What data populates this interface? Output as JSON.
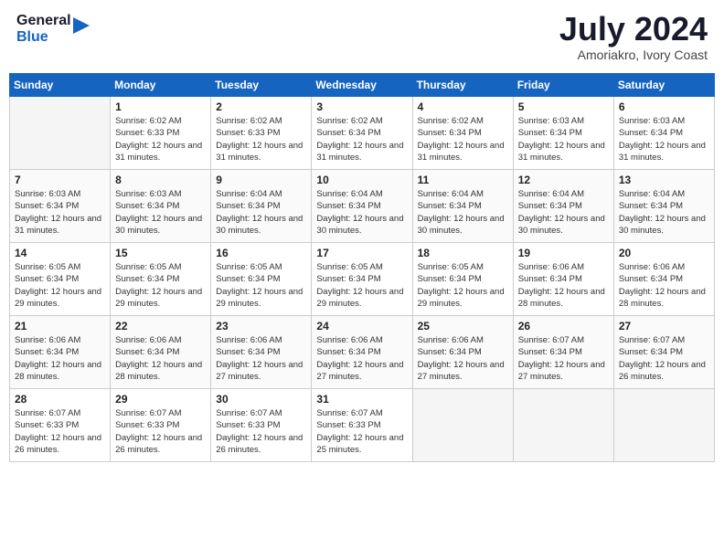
{
  "header": {
    "logo_line1": "General",
    "logo_line2": "Blue",
    "month": "July 2024",
    "location": "Amoriakro, Ivory Coast"
  },
  "days_of_week": [
    "Sunday",
    "Monday",
    "Tuesday",
    "Wednesday",
    "Thursday",
    "Friday",
    "Saturday"
  ],
  "weeks": [
    [
      {
        "day": "",
        "empty": true
      },
      {
        "day": "1",
        "sunrise": "6:02 AM",
        "sunset": "6:33 PM",
        "daylight": "12 hours and 31 minutes."
      },
      {
        "day": "2",
        "sunrise": "6:02 AM",
        "sunset": "6:33 PM",
        "daylight": "12 hours and 31 minutes."
      },
      {
        "day": "3",
        "sunrise": "6:02 AM",
        "sunset": "6:34 PM",
        "daylight": "12 hours and 31 minutes."
      },
      {
        "day": "4",
        "sunrise": "6:02 AM",
        "sunset": "6:34 PM",
        "daylight": "12 hours and 31 minutes."
      },
      {
        "day": "5",
        "sunrise": "6:03 AM",
        "sunset": "6:34 PM",
        "daylight": "12 hours and 31 minutes."
      },
      {
        "day": "6",
        "sunrise": "6:03 AM",
        "sunset": "6:34 PM",
        "daylight": "12 hours and 31 minutes."
      }
    ],
    [
      {
        "day": "7",
        "sunrise": "6:03 AM",
        "sunset": "6:34 PM",
        "daylight": "12 hours and 31 minutes."
      },
      {
        "day": "8",
        "sunrise": "6:03 AM",
        "sunset": "6:34 PM",
        "daylight": "12 hours and 30 minutes."
      },
      {
        "day": "9",
        "sunrise": "6:04 AM",
        "sunset": "6:34 PM",
        "daylight": "12 hours and 30 minutes."
      },
      {
        "day": "10",
        "sunrise": "6:04 AM",
        "sunset": "6:34 PM",
        "daylight": "12 hours and 30 minutes."
      },
      {
        "day": "11",
        "sunrise": "6:04 AM",
        "sunset": "6:34 PM",
        "daylight": "12 hours and 30 minutes."
      },
      {
        "day": "12",
        "sunrise": "6:04 AM",
        "sunset": "6:34 PM",
        "daylight": "12 hours and 30 minutes."
      },
      {
        "day": "13",
        "sunrise": "6:04 AM",
        "sunset": "6:34 PM",
        "daylight": "12 hours and 30 minutes."
      }
    ],
    [
      {
        "day": "14",
        "sunrise": "6:05 AM",
        "sunset": "6:34 PM",
        "daylight": "12 hours and 29 minutes."
      },
      {
        "day": "15",
        "sunrise": "6:05 AM",
        "sunset": "6:34 PM",
        "daylight": "12 hours and 29 minutes."
      },
      {
        "day": "16",
        "sunrise": "6:05 AM",
        "sunset": "6:34 PM",
        "daylight": "12 hours and 29 minutes."
      },
      {
        "day": "17",
        "sunrise": "6:05 AM",
        "sunset": "6:34 PM",
        "daylight": "12 hours and 29 minutes."
      },
      {
        "day": "18",
        "sunrise": "6:05 AM",
        "sunset": "6:34 PM",
        "daylight": "12 hours and 29 minutes."
      },
      {
        "day": "19",
        "sunrise": "6:06 AM",
        "sunset": "6:34 PM",
        "daylight": "12 hours and 28 minutes."
      },
      {
        "day": "20",
        "sunrise": "6:06 AM",
        "sunset": "6:34 PM",
        "daylight": "12 hours and 28 minutes."
      }
    ],
    [
      {
        "day": "21",
        "sunrise": "6:06 AM",
        "sunset": "6:34 PM",
        "daylight": "12 hours and 28 minutes."
      },
      {
        "day": "22",
        "sunrise": "6:06 AM",
        "sunset": "6:34 PM",
        "daylight": "12 hours and 28 minutes."
      },
      {
        "day": "23",
        "sunrise": "6:06 AM",
        "sunset": "6:34 PM",
        "daylight": "12 hours and 27 minutes."
      },
      {
        "day": "24",
        "sunrise": "6:06 AM",
        "sunset": "6:34 PM",
        "daylight": "12 hours and 27 minutes."
      },
      {
        "day": "25",
        "sunrise": "6:06 AM",
        "sunset": "6:34 PM",
        "daylight": "12 hours and 27 minutes."
      },
      {
        "day": "26",
        "sunrise": "6:07 AM",
        "sunset": "6:34 PM",
        "daylight": "12 hours and 27 minutes."
      },
      {
        "day": "27",
        "sunrise": "6:07 AM",
        "sunset": "6:34 PM",
        "daylight": "12 hours and 26 minutes."
      }
    ],
    [
      {
        "day": "28",
        "sunrise": "6:07 AM",
        "sunset": "6:33 PM",
        "daylight": "12 hours and 26 minutes."
      },
      {
        "day": "29",
        "sunrise": "6:07 AM",
        "sunset": "6:33 PM",
        "daylight": "12 hours and 26 minutes."
      },
      {
        "day": "30",
        "sunrise": "6:07 AM",
        "sunset": "6:33 PM",
        "daylight": "12 hours and 26 minutes."
      },
      {
        "day": "31",
        "sunrise": "6:07 AM",
        "sunset": "6:33 PM",
        "daylight": "12 hours and 25 minutes."
      },
      {
        "day": "",
        "empty": true
      },
      {
        "day": "",
        "empty": true
      },
      {
        "day": "",
        "empty": true
      }
    ]
  ]
}
